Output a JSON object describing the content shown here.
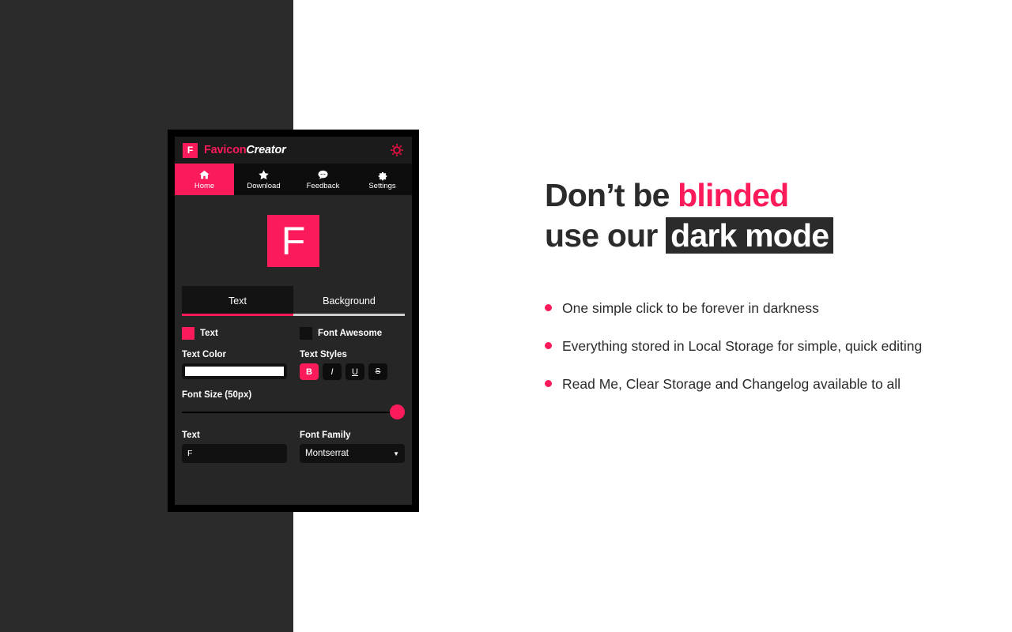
{
  "colors": {
    "accent": "#fb1b5b",
    "dark_bg": "#2b2b2b",
    "panel_bg": "#262626",
    "panel_dark": "#1b1b1b",
    "white": "#ffffff"
  },
  "app": {
    "logo_badge": "F",
    "logo_name_a": "Favicon",
    "logo_name_b": "Creator",
    "header_gear_icon": "gear-icon",
    "nav_tabs": [
      {
        "label": "Home",
        "icon": "home-icon",
        "active": true
      },
      {
        "label": "Download",
        "icon": "star-icon",
        "active": false
      },
      {
        "label": "Feedback",
        "icon": "comment-icon",
        "active": false
      },
      {
        "label": "Settings",
        "icon": "gear-icon",
        "active": false
      }
    ],
    "preview": {
      "letter": "F"
    },
    "segmented_tabs": [
      {
        "label": "Text",
        "active": true
      },
      {
        "label": "Background",
        "active": false
      }
    ],
    "checkboxes": [
      {
        "label": "Text",
        "checked": true
      },
      {
        "label": "Font Awesome",
        "checked": false
      }
    ],
    "text_color": {
      "label": "Text Color",
      "value": "#ffffff"
    },
    "text_styles": {
      "label": "Text Styles",
      "buttons": [
        {
          "label": "B",
          "active": true
        },
        {
          "label": "I",
          "active": false
        },
        {
          "label": "U",
          "active": false
        },
        {
          "label": "S",
          "active": false
        }
      ]
    },
    "font_size": {
      "label": "Font Size (50px)",
      "value": 50,
      "percent": 100
    },
    "text_field": {
      "label": "Text",
      "value": "F",
      "placeholder": "Text"
    },
    "font_family": {
      "label": "Font Family",
      "value": "Montserrat"
    }
  },
  "marketing": {
    "headline_line1_a": "Don’t be ",
    "headline_line1_b": "blinded",
    "headline_line2_a": "use our ",
    "headline_line2_b": "dark mode",
    "bullets": [
      "One simple click to be forever in darkness",
      "Everything stored in Local Storage for simple, quick editing",
      "Read Me, Clear Storage and Changelog available to all"
    ]
  }
}
